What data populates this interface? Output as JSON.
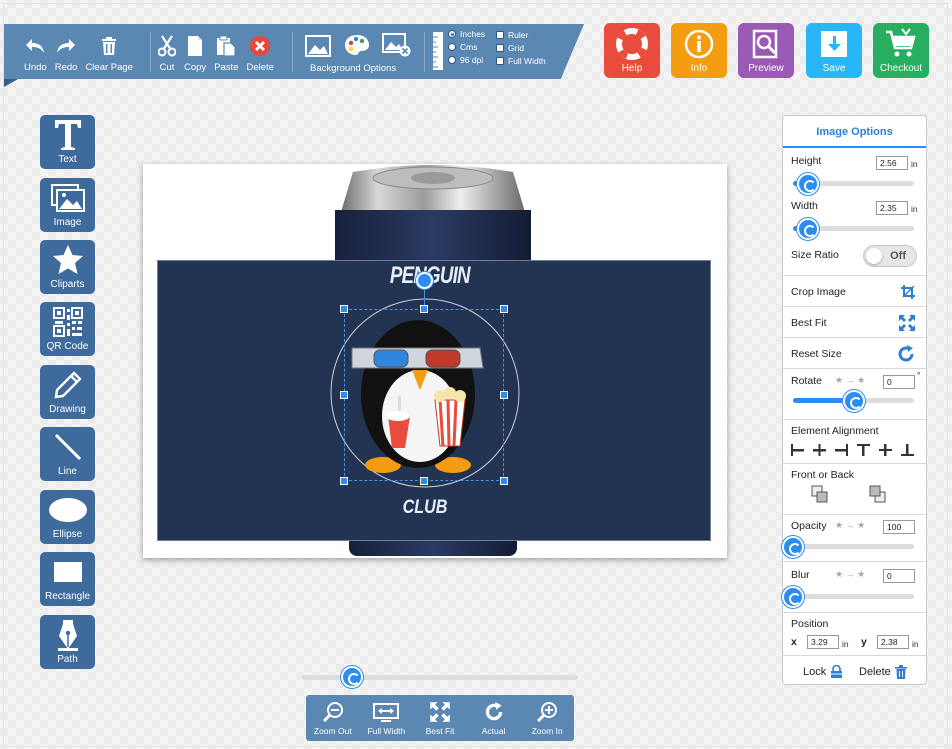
{
  "toolbar": {
    "undo": "Undo",
    "redo": "Redo",
    "clear_page": "Clear Page",
    "cut": "Cut",
    "copy": "Copy",
    "paste": "Paste",
    "delete": "Delete",
    "background_options": "Background Options",
    "units": {
      "inches": "Inches",
      "cms": "Cms",
      "dpi": "96 dpi",
      "selected": "Inches"
    },
    "toggles": {
      "ruler": "Ruler",
      "grid": "Grid",
      "full_width": "Full Width"
    }
  },
  "actions": {
    "help": "Help",
    "info": "Info",
    "preview": "Preview",
    "save": "Save",
    "checkout": "Checkout",
    "colors": {
      "help": "#e94b3c",
      "info": "#f59d11",
      "preview": "#9b59b6",
      "save": "#29b6f6",
      "checkout": "#27ae60"
    }
  },
  "tools": [
    {
      "label": "Text",
      "icon": "text-icon"
    },
    {
      "label": "Image",
      "icon": "image-icon"
    },
    {
      "label": "Cliparts",
      "icon": "star-icon"
    },
    {
      "label": "QR Code",
      "icon": "qr-code-icon"
    },
    {
      "label": "Drawing",
      "icon": "pencil-icon"
    },
    {
      "label": "Line",
      "icon": "line-icon"
    },
    {
      "label": "Ellipse",
      "icon": "ellipse-icon"
    },
    {
      "label": "Rectangle",
      "icon": "rectangle-icon"
    },
    {
      "label": "Path",
      "icon": "pen-nib-icon"
    }
  ],
  "canvas": {
    "top_text": "PENGUIN",
    "bottom_text": "CLUB",
    "design_color": "#233453"
  },
  "image_options": {
    "title": "Image Options",
    "height_label": "Height",
    "height_value": "2.56",
    "height_unit": "in",
    "height_slider": 0.12,
    "width_label": "Width",
    "width_value": "2.35",
    "width_unit": "in",
    "width_slider": 0.12,
    "size_ratio_label": "Size Ratio",
    "size_ratio_state": "Off",
    "crop_label": "Crop Image",
    "best_fit_label": "Best Fit",
    "reset_size_label": "Reset Size",
    "rotate_label": "Rotate",
    "rotate_value": "0",
    "rotate_unit": "°",
    "rotate_slider": 0.5,
    "alignment_label": "Element Alignment",
    "front_back_label": "Front or Back",
    "opacity_label": "Opacity",
    "opacity_value": "100",
    "opacity_slider": 0,
    "blur_label": "Blur",
    "blur_value": "0",
    "blur_slider": 0,
    "position_label": "Position",
    "x_label": "x",
    "x_value": "3.29",
    "x_unit": "in",
    "y_label": "y",
    "y_value": "2.38",
    "y_unit": "in",
    "lock_label": "Lock",
    "delete_label": "Delete"
  },
  "zoom": {
    "slider": 0.18,
    "zoom_out": "Zoom Out",
    "full_width": "Full Width",
    "best_fit": "Best Fit",
    "actual": "Actual",
    "zoom_in": "Zoom In"
  }
}
